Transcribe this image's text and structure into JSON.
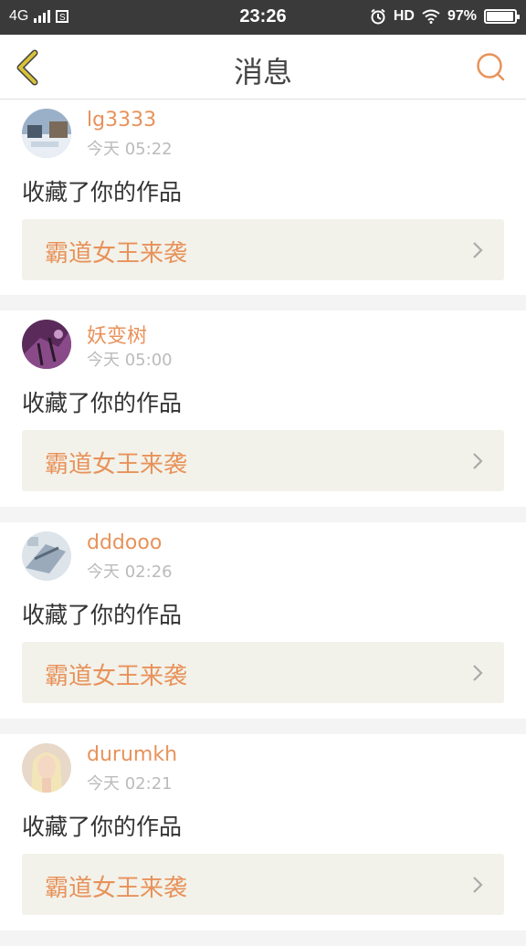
{
  "status_bar": {
    "network": "4G",
    "sim_icon": "sim-icon",
    "time": "23:26",
    "alarm_icon": "alarm-icon",
    "hd": "HD",
    "wifi_icon": "wifi-icon",
    "battery_pct": "97%",
    "battery_level": 0.97
  },
  "header": {
    "back_icon": "back-chevron-icon",
    "title": "消息",
    "search_icon": "search-icon"
  },
  "colors": {
    "accent": "#e8925a",
    "back_icon": "#d8c23a",
    "status_bg": "#3a3a3a",
    "card_work_bg": "#f2f2ea"
  },
  "messages": [
    {
      "username": "lg3333",
      "time": "今天 05:22",
      "action": "收藏了你的作品",
      "work_title": "霸道女王来袭"
    },
    {
      "username": "妖变树",
      "time": "今天 05:00",
      "action": "收藏了你的作品",
      "work_title": "霸道女王来袭"
    },
    {
      "username": "dddooo",
      "time": "今天 02:26",
      "action": "收藏了你的作品",
      "work_title": "霸道女王来袭"
    },
    {
      "username": "durumkh",
      "time": "今天 02:21",
      "action": "收藏了你的作品",
      "work_title": "霸道女王来袭"
    }
  ]
}
